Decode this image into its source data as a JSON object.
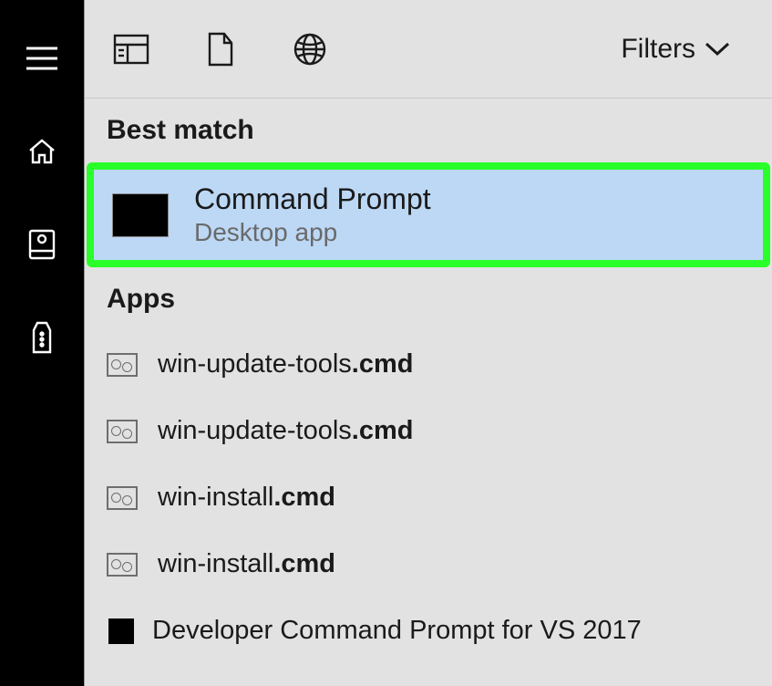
{
  "rail": {
    "items": [
      "menu",
      "home",
      "camera",
      "remote"
    ]
  },
  "toolbar": {
    "icons": [
      "apps",
      "documents",
      "web"
    ],
    "filters_label": "Filters"
  },
  "sections": {
    "best_match_label": "Best match",
    "apps_label": "Apps"
  },
  "best_match": {
    "title": "Command Prompt",
    "subtitle": "Desktop app"
  },
  "apps": [
    {
      "name": "win-update-tools",
      "ext": ".cmd",
      "icon": "cmd-file"
    },
    {
      "name": "win-update-tools",
      "ext": ".cmd",
      "icon": "cmd-file"
    },
    {
      "name": "win-install",
      "ext": ".cmd",
      "icon": "cmd-file"
    },
    {
      "name": "win-install",
      "ext": ".cmd",
      "icon": "cmd-file"
    },
    {
      "name": "Developer Command Prompt for VS 2017",
      "ext": "",
      "icon": "black-box"
    }
  ]
}
